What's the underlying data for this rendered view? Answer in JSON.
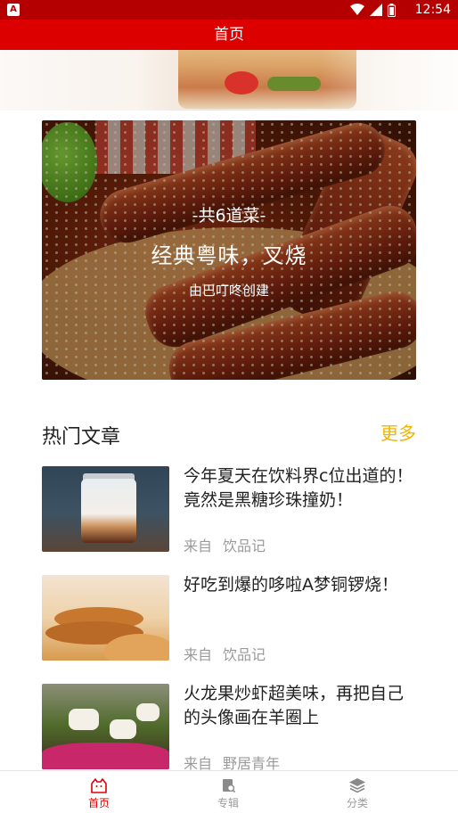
{
  "status_bar": {
    "app_badge": "A",
    "time": "12:54",
    "icons": [
      "wifi-icon",
      "signal-icon",
      "battery-icon"
    ]
  },
  "app_bar": {
    "title": "首页"
  },
  "feature": {
    "count_text": "-共6道菜-",
    "title": "经典粤味，叉烧",
    "creator": "由巴叮咚创建"
  },
  "section": {
    "title": "热门文章",
    "more_label": "更多"
  },
  "articles": [
    {
      "title": "今年夏天在饮料界c位出道的！竟然是黑糖珍珠撞奶！",
      "from_label": "来自",
      "source": "饮品记"
    },
    {
      "title": "好吃到爆的哆啦A梦铜锣烧！",
      "from_label": "来自",
      "source": "饮品记"
    },
    {
      "title": "火龙果炒虾超美味，再把自己的头像画在羊圈上",
      "from_label": "来自",
      "source": "野居青年"
    }
  ],
  "tabs": [
    {
      "label": "首页",
      "icon": "home-icon",
      "active": true
    },
    {
      "label": "专辑",
      "icon": "album-icon",
      "active": false
    },
    {
      "label": "分类",
      "icon": "category-layers-icon",
      "active": false
    }
  ],
  "colors": {
    "status_bar": "#b40000",
    "app_bar": "#dd0000",
    "accent_more": "#f0b400",
    "tab_active": "#dd0000",
    "tab_inactive": "#9a9a9a"
  }
}
